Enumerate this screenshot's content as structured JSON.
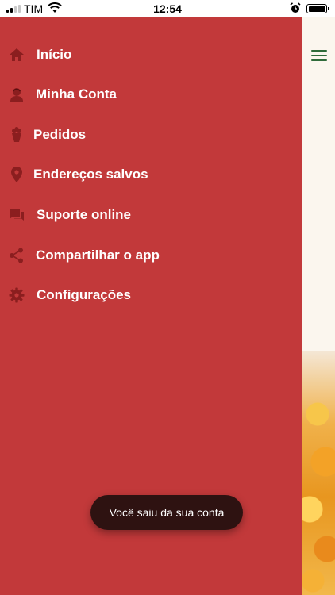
{
  "status_bar": {
    "carrier": "TIM",
    "time": "12:54",
    "signal_bars": 4,
    "signal_active": 2,
    "wifi_icon": "wifi-icon",
    "alarm_icon": "alarm-clock-icon",
    "battery_level": 1.0
  },
  "drawer": {
    "background": "#c2393a",
    "icon_color": "#8b1e1f",
    "items": [
      {
        "label": "Início",
        "icon": "home-icon"
      },
      {
        "label": "Minha Conta",
        "icon": "account-icon"
      },
      {
        "label": "Pedidos",
        "icon": "flower-bouquet-icon"
      },
      {
        "label": "Endereços salvos",
        "icon": "location-pin-icon"
      },
      {
        "label": "Suporte online",
        "icon": "chat-icon"
      },
      {
        "label": "Compartilhar o app",
        "icon": "share-icon"
      },
      {
        "label": "Configurações",
        "icon": "gear-icon"
      }
    ]
  },
  "header": {
    "menu_icon": "hamburger-menu-icon",
    "menu_icon_color": "#2f6b3a"
  },
  "toast": {
    "message": "Você saiu da sua conta"
  }
}
